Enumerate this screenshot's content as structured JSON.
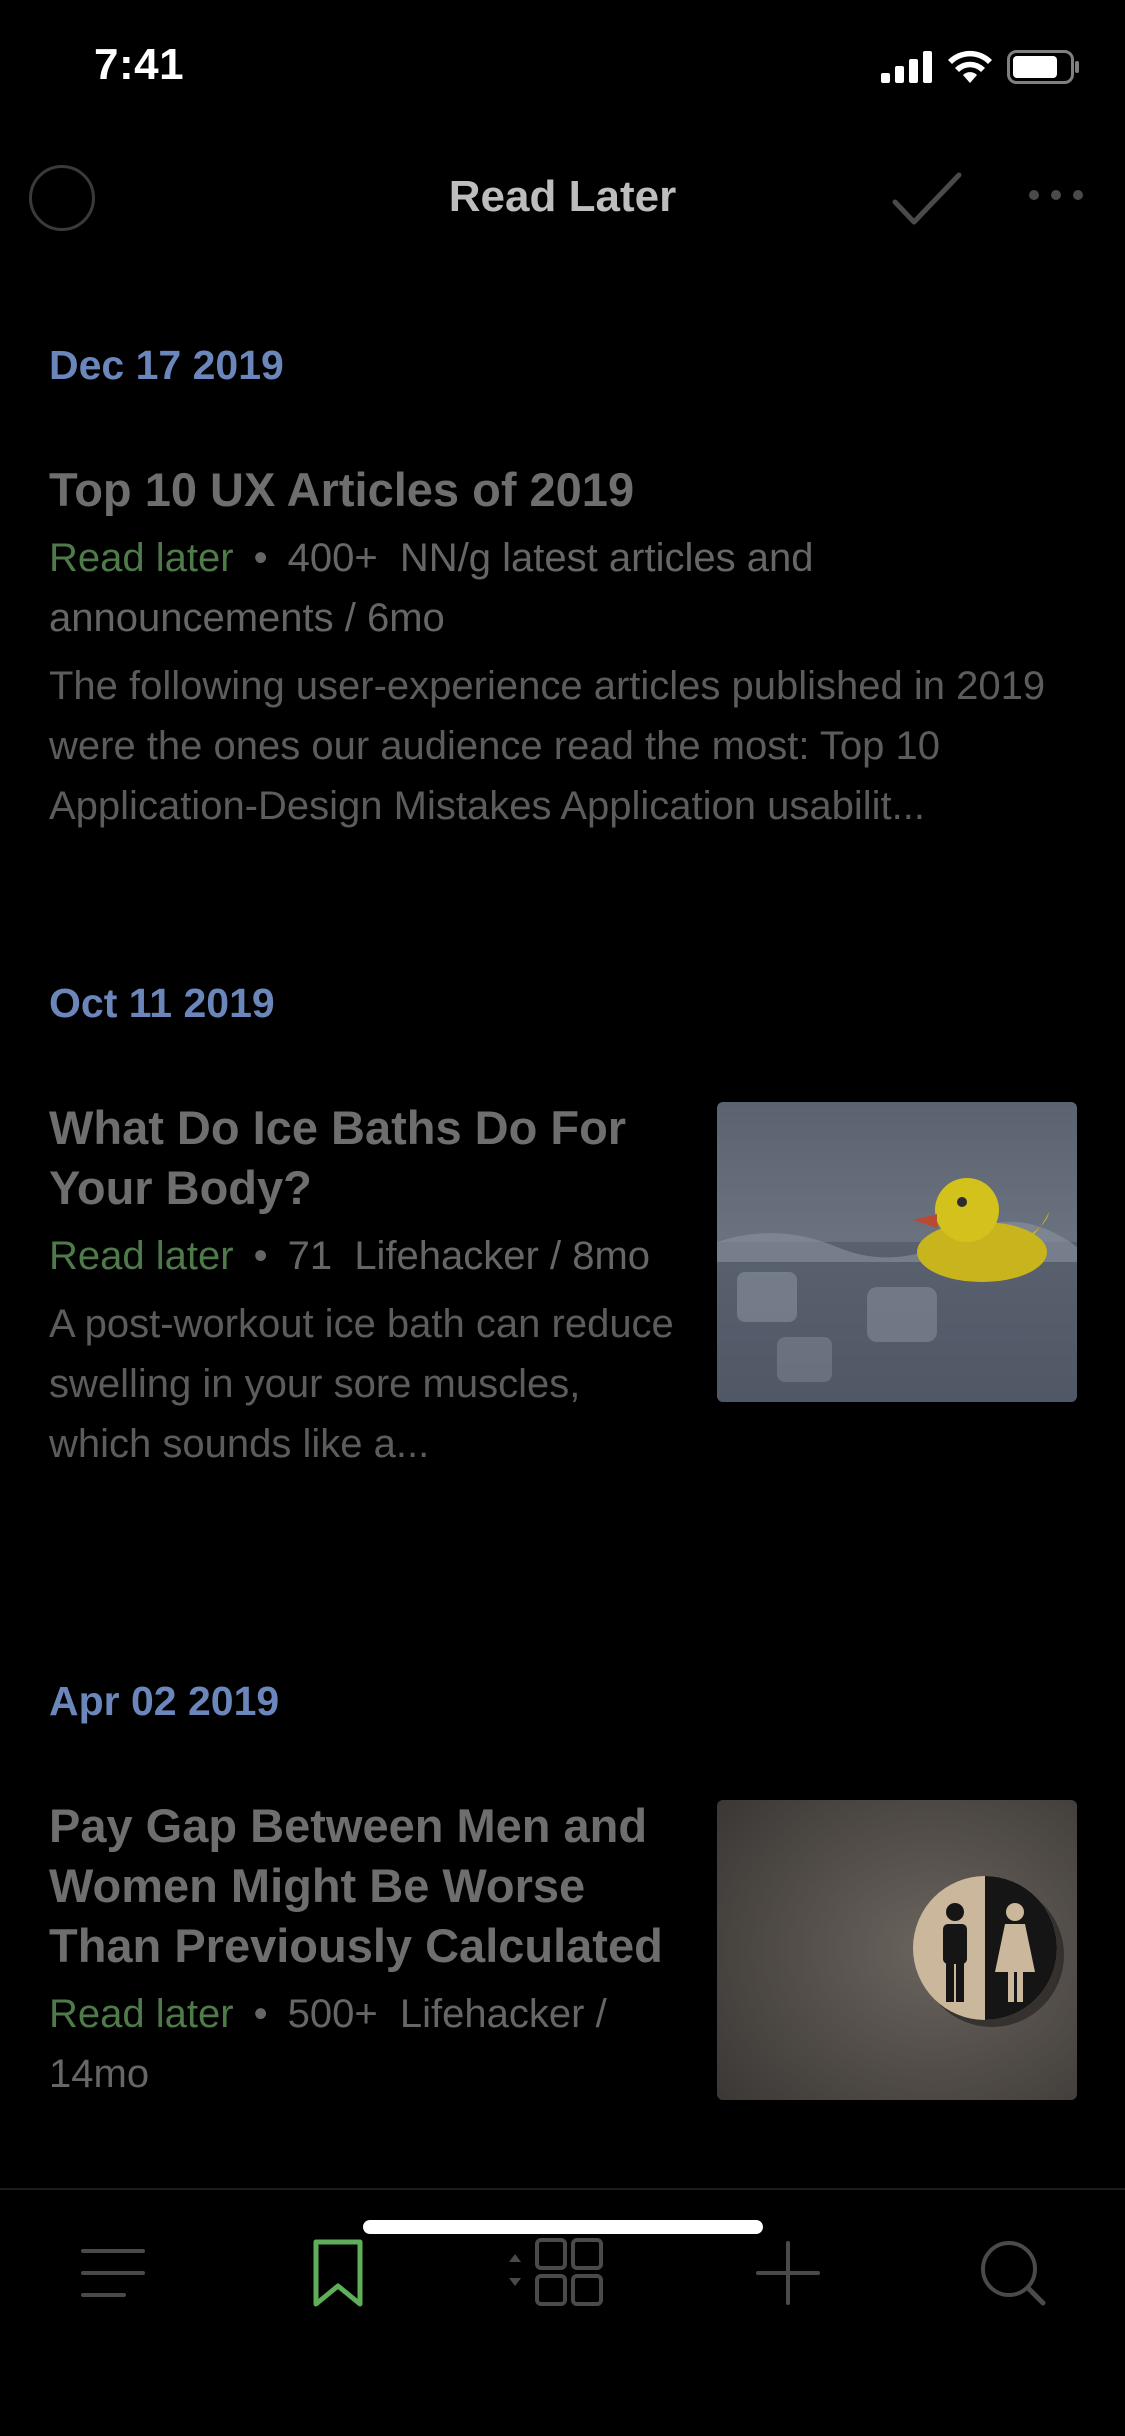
{
  "status_bar": {
    "time": "7:41"
  },
  "nav": {
    "title": "Read Later"
  },
  "sections": [
    {
      "date": "Dec 17 2019",
      "articles": [
        {
          "title": "Top 10 UX Articles of 2019",
          "tag": "Read later",
          "count": "400+",
          "meta_rest": "NN/g latest articles and announcements / 6mo",
          "description": "The following user-experience articles published in 2019 were the ones our audience read the most: Top 10 Application-Design Mistakes Application usabilit..."
        }
      ]
    },
    {
      "date": "Oct 11 2019",
      "articles": [
        {
          "title": "What Do Ice Baths Do For Your Body?",
          "tag": "Read later",
          "count": "71",
          "meta_rest": "Lifehacker / 8mo",
          "description": "A post-workout ice bath can reduce swelling in your sore muscles, which sounds like a..."
        }
      ]
    },
    {
      "date": "Apr 02 2019",
      "articles": [
        {
          "title": "Pay Gap Between Men and Women Might Be Worse Than Previously Calculated",
          "tag": "Read later",
          "count": "500+",
          "meta_rest": "Lifehacker / 14mo"
        }
      ]
    }
  ],
  "tab_bar": {
    "items": [
      {
        "icon": "menu-icon",
        "active": false
      },
      {
        "icon": "bookmark-icon",
        "active": true
      },
      {
        "icon": "grid-sort-icon",
        "active": false
      },
      {
        "icon": "plus-icon",
        "active": false
      },
      {
        "icon": "search-icon",
        "active": false
      }
    ]
  },
  "colors": {
    "background": "#000000",
    "date_accent": "#6b86bb",
    "tag_green": "#4f7a4a",
    "active_tab": "#5fae5a"
  }
}
